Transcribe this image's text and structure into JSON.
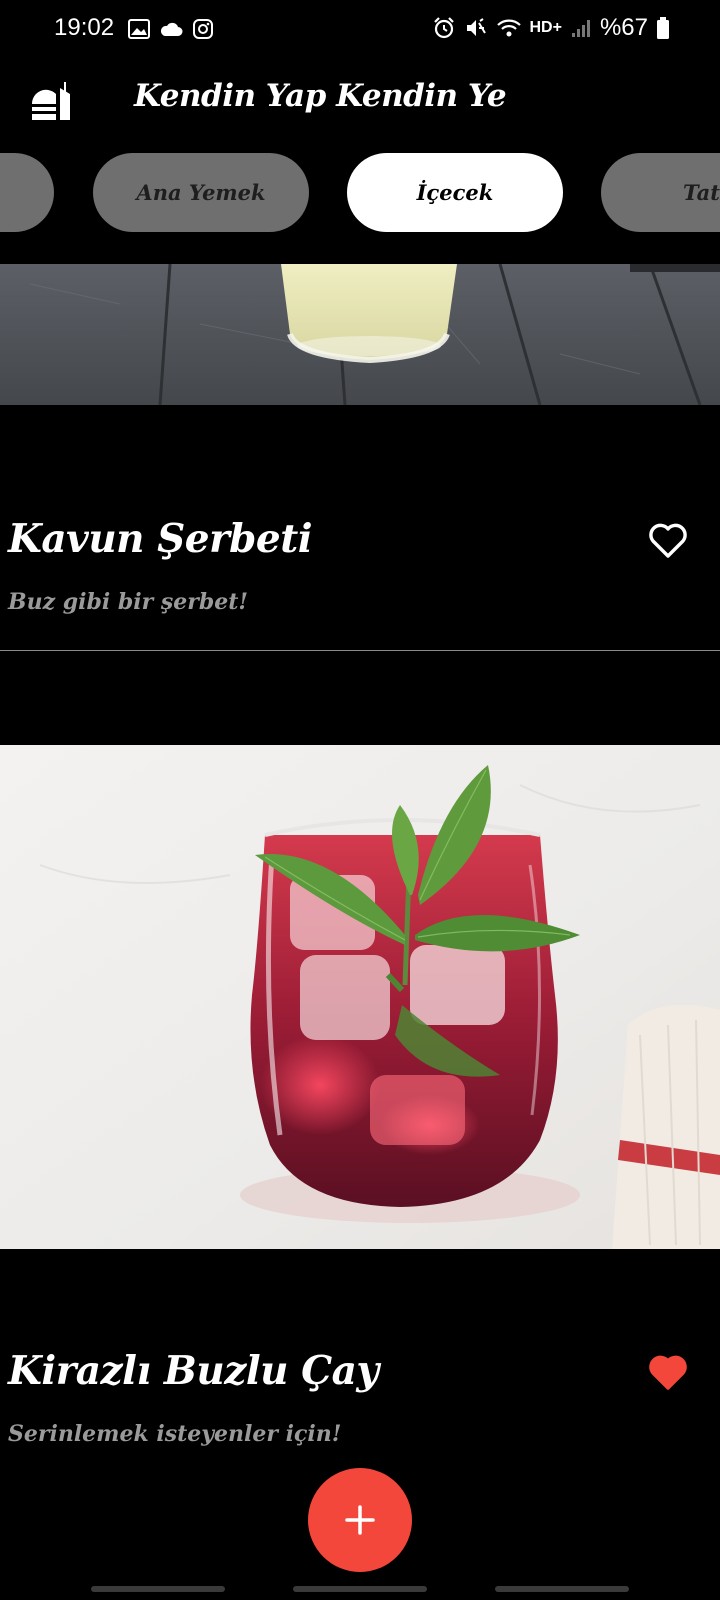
{
  "status_bar": {
    "time": "19:02",
    "network": "HD+",
    "battery": "%67",
    "left_icons": [
      "gallery-icon",
      "cloud-icon",
      "instagram-icon"
    ],
    "right_icons": [
      "alarm-icon",
      "mute-icon",
      "wifi-icon",
      "signal-icon",
      "battery-icon"
    ]
  },
  "app_bar": {
    "title": "Kendin Yap Kendin Ye",
    "logo_icon": "food-icon"
  },
  "categories": {
    "items": [
      {
        "label": "",
        "active": false
      },
      {
        "label": "Ana Yemek",
        "active": false
      },
      {
        "label": "İçecek",
        "active": true
      },
      {
        "label": "Tatlı",
        "active": false
      }
    ]
  },
  "recipes": [
    {
      "title": "Kavun Şerbeti",
      "subtitle": "Buz gibi bir şerbet!",
      "favorite": false
    },
    {
      "title": "Kirazlı Buzlu Çay",
      "subtitle": "Serinlemek isteyenler için!",
      "favorite": true
    }
  ],
  "fab": {
    "icon": "plus-icon"
  },
  "colors": {
    "background": "#000000",
    "chip_inactive": "#6f6f6f",
    "chip_active": "#ffffff",
    "accent": "#f4473b",
    "subtitle": "#9a9a9a"
  }
}
